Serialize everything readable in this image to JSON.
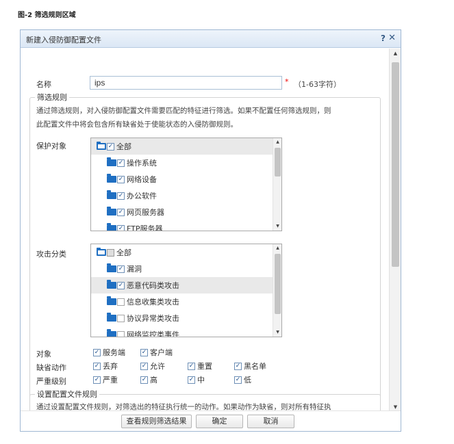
{
  "caption": "图-2 筛选规则区域",
  "dialog": {
    "title": "新建入侵防御配置文件",
    "help": "?",
    "close": "✕",
    "name_label": "名称",
    "name_value": "ips",
    "required_mark": "*",
    "name_hint": "（1-63字符）",
    "filter": {
      "legend": "筛选规则",
      "desc_line1": "通过筛选规则，对入侵防御配置文件需要匹配的特征进行筛选。如果不配置任何筛选规则，则",
      "desc_line2": "此配置文件中将会包含所有缺省处于使能状态的入侵防御规则。",
      "protect_label": "保护对象",
      "protect_items": [
        {
          "label": "全部",
          "checked": true,
          "root": true
        },
        {
          "label": "操作系统",
          "checked": true
        },
        {
          "label": "网络设备",
          "checked": true
        },
        {
          "label": "办公软件",
          "checked": true
        },
        {
          "label": "网页服务器",
          "checked": true
        },
        {
          "label": "FTP服务器",
          "checked": true
        }
      ],
      "attack_label": "攻击分类",
      "attack_items": [
        {
          "label": "全部",
          "state": "partial",
          "root": true
        },
        {
          "label": "漏洞",
          "checked": true
        },
        {
          "label": "恶意代码类攻击",
          "checked": true,
          "selected": true
        },
        {
          "label": "信息收集类攻击",
          "checked": false
        },
        {
          "label": "协议异常类攻击",
          "checked": false
        },
        {
          "label": "网络监控类事件",
          "checked": false
        }
      ],
      "target_label": "对象",
      "target_options": [
        {
          "label": "服务端",
          "checked": true
        },
        {
          "label": "客户端",
          "checked": true
        }
      ],
      "action_label": "缺省动作",
      "action_options": [
        {
          "label": "丢弃",
          "checked": true
        },
        {
          "label": "允许",
          "checked": true
        },
        {
          "label": "重置",
          "checked": true
        },
        {
          "label": "黑名单",
          "checked": true
        }
      ],
      "severity_label": "严重级别",
      "severity_options": [
        {
          "label": "严重",
          "checked": true
        },
        {
          "label": "高",
          "checked": true
        },
        {
          "label": "中",
          "checked": true
        },
        {
          "label": "低",
          "checked": true
        }
      ]
    },
    "profile": {
      "legend": "设置配置文件规则",
      "desc_line1": "通过设置配置文件规则，对筛选出的特征执行统一的动作。如果动作为缺省，则对所有特征执"
    },
    "buttons": {
      "view": "查看规则筛选结果",
      "ok": "确定",
      "cancel": "取消"
    },
    "colors": {
      "accent": "#1f6fc2",
      "titlebar": "#dbe7f5",
      "required": "#ee0000"
    }
  }
}
